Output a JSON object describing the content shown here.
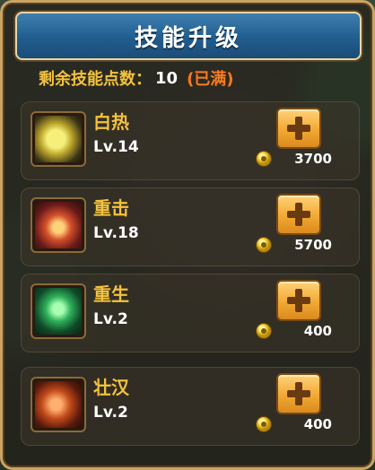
{
  "header": {
    "title": "技能升级"
  },
  "points": {
    "label": "剩余技能点数：",
    "value": "10",
    "status": "(已满)"
  },
  "skills": [
    {
      "name": "白热",
      "level": "Lv.14",
      "cost": "3700",
      "icon": "lightning-skill-icon"
    },
    {
      "name": "重击",
      "level": "Lv.18",
      "cost": "5700",
      "icon": "heavy-strike-skill-icon"
    },
    {
      "name": "重生",
      "level": "Lv.2",
      "cost": "400",
      "icon": "rebirth-skill-icon"
    },
    {
      "name": "壮汉",
      "level": "Lv.2",
      "cost": "400",
      "icon": "strongman-skill-icon"
    }
  ],
  "colors": {
    "title_bg": "#2a6a9e",
    "gold_text": "#f4c23c",
    "full_text": "#ff7a1c",
    "button": "#f2a933"
  }
}
